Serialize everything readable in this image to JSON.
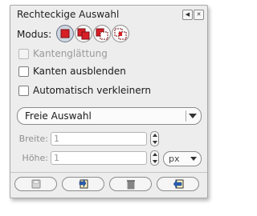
{
  "panel": {
    "title": "Rechteckige Auswahl",
    "title_icons": [
      "tab-menu-icon",
      "close-icon"
    ]
  },
  "modus": {
    "label": "Modus:",
    "modes": [
      {
        "icon": "replace-selection-icon",
        "active": true
      },
      {
        "icon": "add-to-selection-icon",
        "active": false
      },
      {
        "icon": "subtract-from-selection-icon",
        "active": false
      },
      {
        "icon": "intersect-selection-icon",
        "active": false
      }
    ]
  },
  "options": {
    "antialias": {
      "label": "Kantenglättung",
      "checked": false,
      "enabled": false
    },
    "feather": {
      "label": "Kanten ausblenden",
      "checked": false,
      "enabled": true
    },
    "autoshrink": {
      "label": "Automatisch verkleinern",
      "checked": false,
      "enabled": true
    }
  },
  "shape": {
    "selected": "Freie Auswahl"
  },
  "size": {
    "width_label": "Breite:",
    "width_value": "1",
    "height_label": "Höhe:",
    "height_value": "1",
    "unit": "px"
  },
  "bottom_buttons": [
    "save-options-icon",
    "restore-options-icon",
    "delete-options-icon",
    "reset-options-icon"
  ],
  "colors": {
    "panel_bg": "#ededed",
    "accent_red": "#d81f26",
    "active_mode": "#cfd6e0"
  }
}
